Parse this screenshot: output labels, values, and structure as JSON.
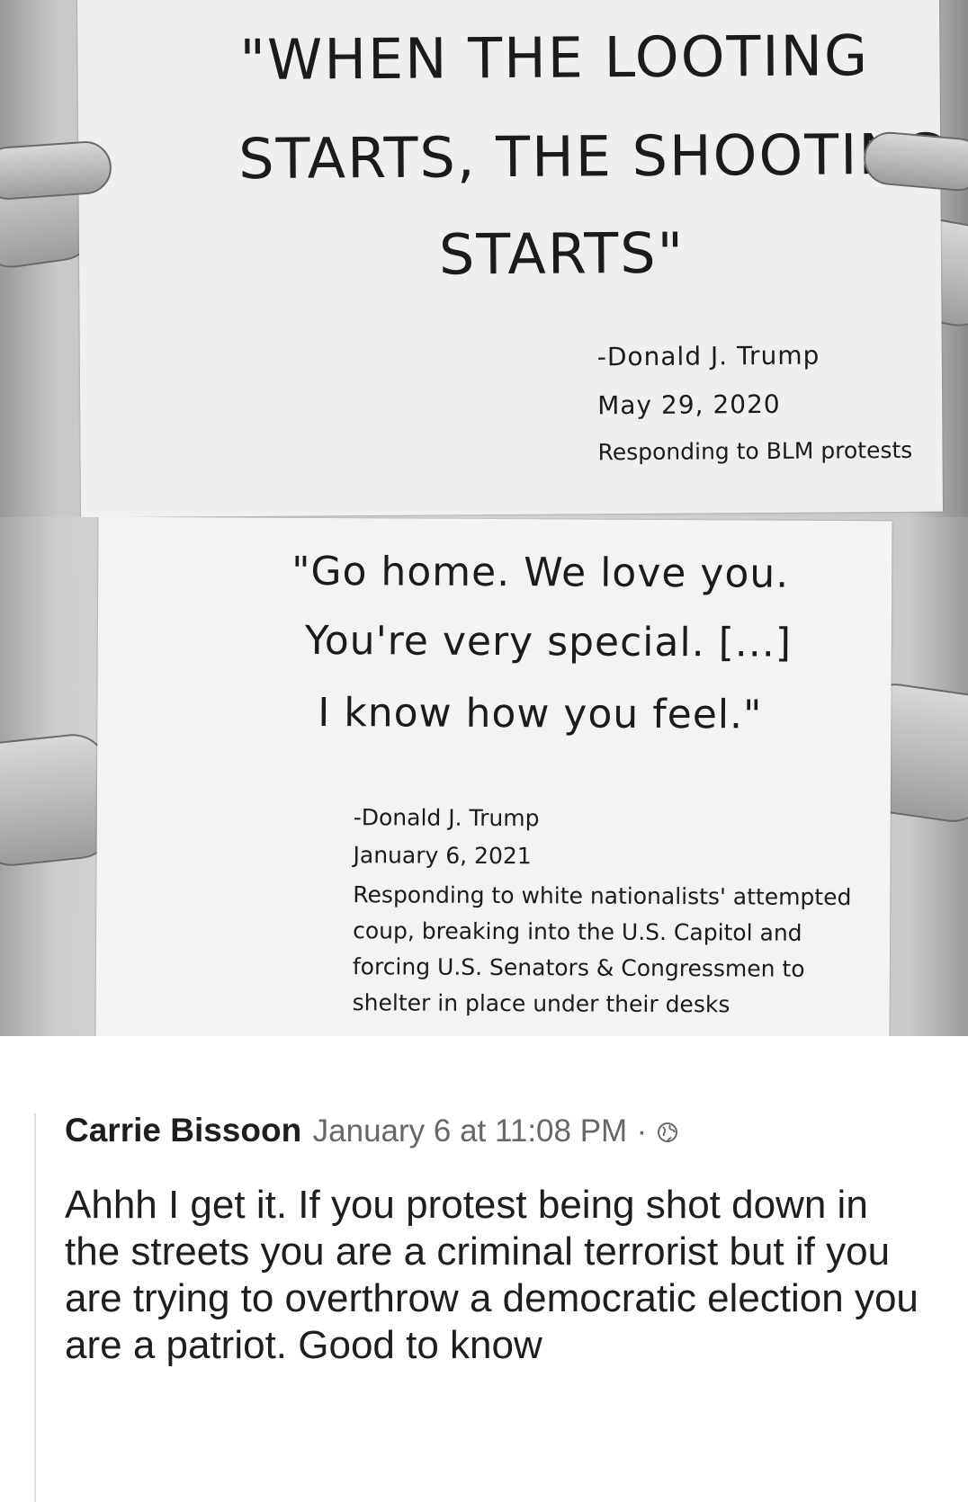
{
  "sign_top": {
    "quote_lines": [
      "\"WHEN THE LOOTING",
      "STARTS, THE SHOOTING",
      "STARTS\""
    ],
    "attribution_lines": [
      "-Donald J. Trump",
      "May 29, 2020",
      "Responding to BLM protests"
    ]
  },
  "sign_bottom": {
    "quote_lines": [
      "\"Go home. We love you.",
      "You're very special. [...]",
      "I know how you feel.\""
    ],
    "attribution_lines": [
      "-Donald J. Trump",
      "January 6, 2021",
      "Responding to white nationalists' attempted",
      "coup, breaking into the U.S. Capitol and",
      "forcing U.S. Senators & Congressmen to",
      "shelter in place under their desks"
    ]
  },
  "comment": {
    "author": "Carrie Bissoon",
    "timestamp": "January 6 at 11:08 PM",
    "separator": "·",
    "privacy_icon": "globe-icon",
    "text": "Ahhh I get it. If you protest being shot down in the streets you are a criminal terrorist but if you are trying to overthrow a democratic election you are a patriot. Good to know"
  }
}
